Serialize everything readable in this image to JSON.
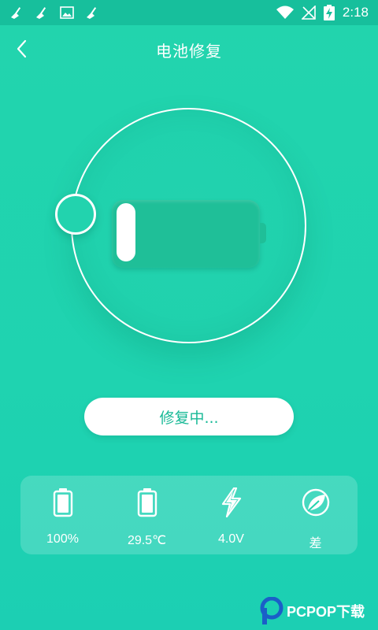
{
  "status_bar": {
    "time": "2:18",
    "icons": [
      "broom-icon",
      "broom-icon",
      "image-icon",
      "broom-icon",
      "wifi-icon",
      "no-signal-icon",
      "battery-charging-icon"
    ]
  },
  "header": {
    "title": "电池修复",
    "back_icon": "chevron-left-icon"
  },
  "repair": {
    "button_label": "修复中..."
  },
  "stats": [
    {
      "icon": "battery-icon",
      "label": "100%"
    },
    {
      "icon": "battery-icon",
      "label": "29.5℃"
    },
    {
      "icon": "lightning-icon",
      "label": "4.0V"
    },
    {
      "icon": "leaf-icon",
      "label": "差"
    }
  ],
  "watermark": {
    "text": "PCPOP下载"
  },
  "colors": {
    "background": "#22d4ad",
    "status_bar": "#17bf9c",
    "button_text": "#17b996",
    "battery_body": "#1fbf98"
  }
}
